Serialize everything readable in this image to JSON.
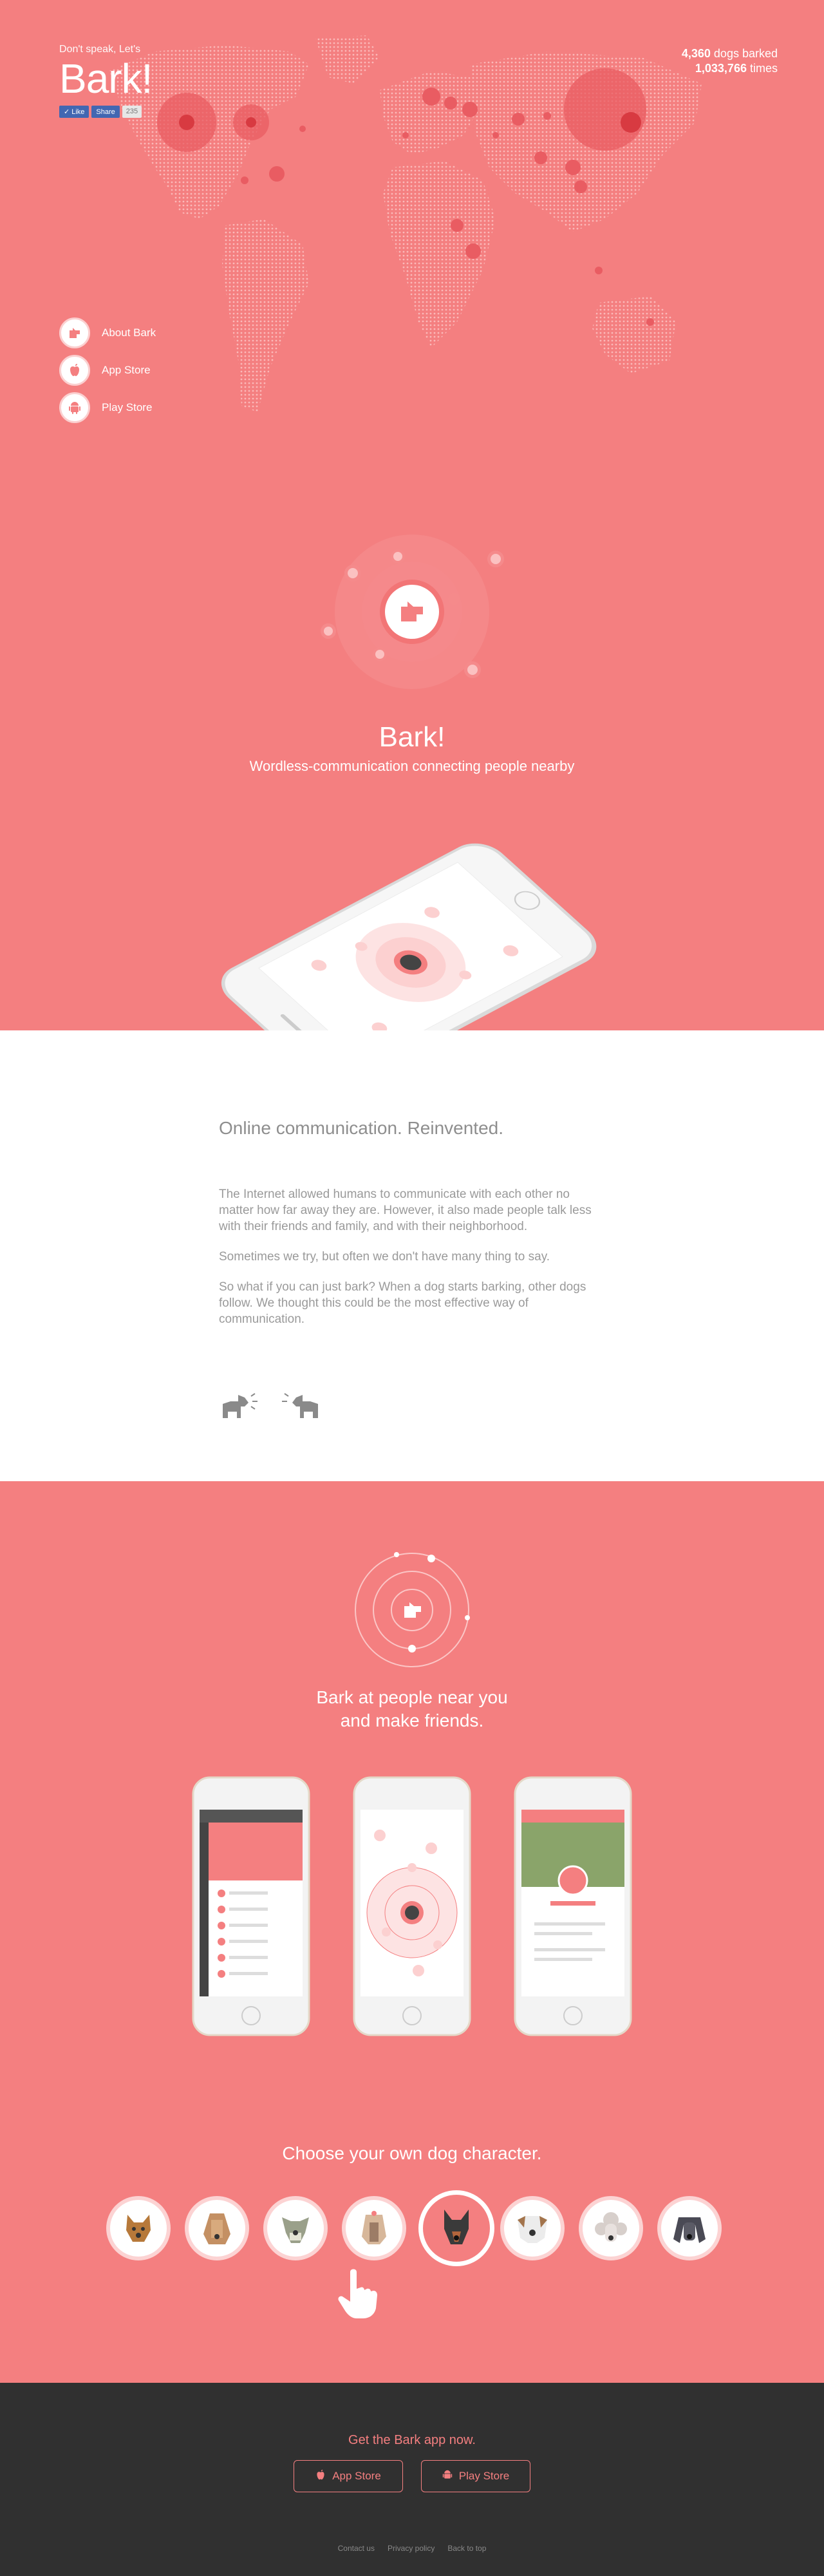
{
  "hero": {
    "tagline": "Don't speak, Let's",
    "brand": "Bark!",
    "like_label": "Like",
    "share_label": "Share",
    "like_count": "235",
    "stats": {
      "dogs_value": "4,360",
      "dogs_label": "dogs barked",
      "times_value": "1,033,766",
      "times_label": "times"
    },
    "side_links": [
      {
        "label": "About Bark",
        "icon": "bark-logo-icon"
      },
      {
        "label": "App Store",
        "icon": "apple-icon"
      },
      {
        "label": "Play Store",
        "icon": "android-icon"
      }
    ],
    "app_title": "Bark!",
    "app_subtitle": "Wordless-communication connecting people nearby",
    "colors": {
      "accent": "#f47f80",
      "map_dot": "#f9b5b5",
      "hotspot": "#e0444a"
    }
  },
  "about": {
    "heading": "Online communication. Reinvented.",
    "paragraphs": [
      "The Internet allowed humans to communicate with each other no matter how far away they are. However, it also made people talk less with their friends and family, and with their neighborhood.",
      "Sometimes we try, but often we don't have many thing to say.",
      "So what if you can just bark? When a dog starts barking, other dogs follow. We thought this could be the most effective way of communication."
    ]
  },
  "features": {
    "title_line1": "Bark at people near you",
    "title_line2": "and make friends.",
    "choose_title": "Choose your own dog character.",
    "characters": [
      "terrier",
      "afghan-hound",
      "schnauzer",
      "yorkshire-terrier",
      "doberman",
      "bulldog",
      "poodle",
      "cocker-spaniel"
    ],
    "selected_character": "doberman"
  },
  "footer": {
    "title": "Get the Bark app now.",
    "app_store": "App Store",
    "play_store": "Play Store",
    "links": [
      "Contact us",
      "Privacy policy",
      "Back to top"
    ],
    "colors": {
      "background": "#303030"
    }
  }
}
